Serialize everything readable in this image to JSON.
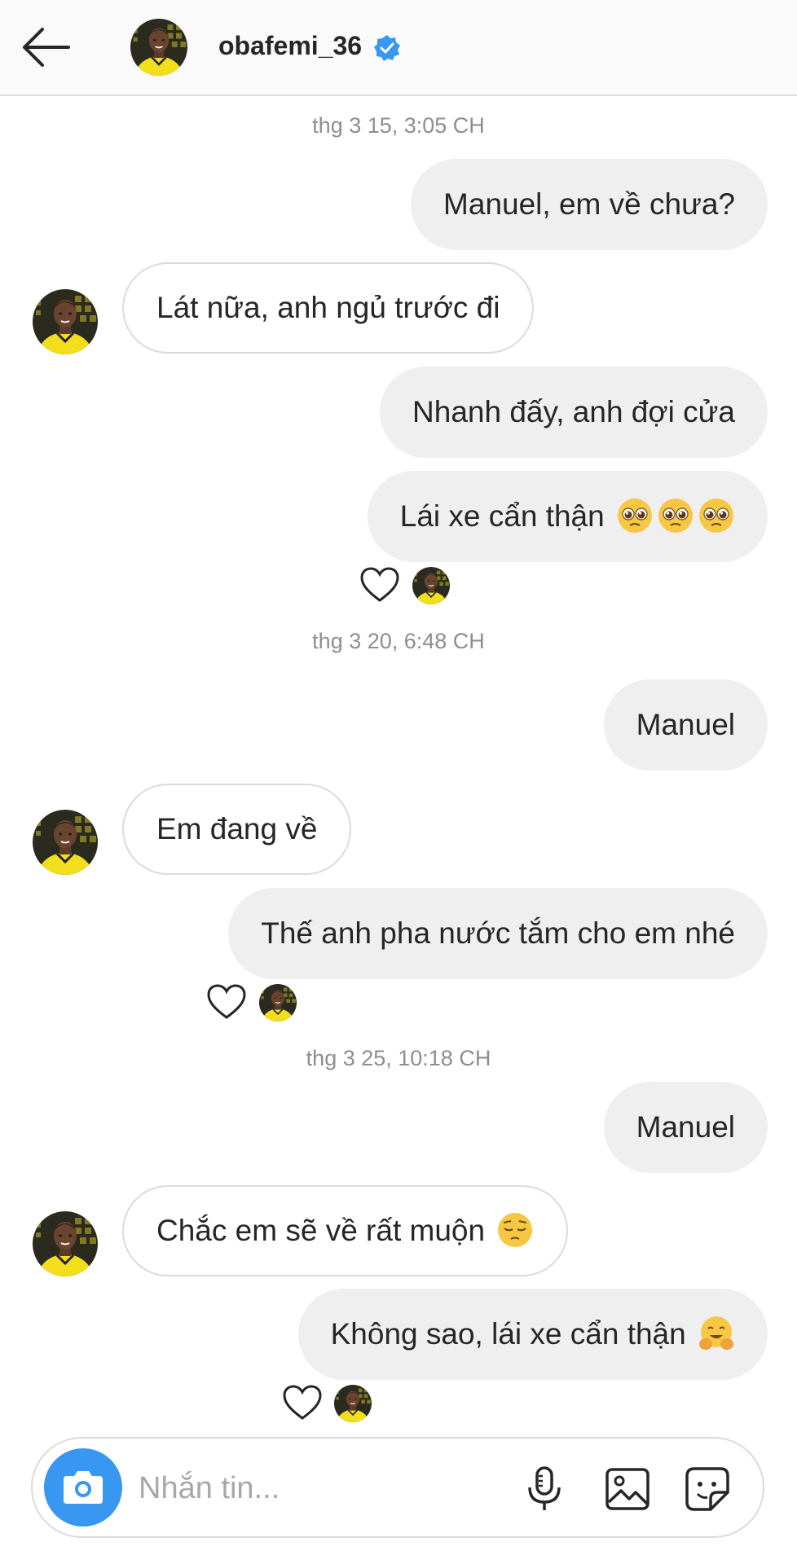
{
  "header": {
    "username": "obafemi_36",
    "back_icon": "arrow-left-icon",
    "verified_icon": "verified-badge-icon",
    "verified_color": "#3897f0"
  },
  "timestamps": [
    "thg 3 15, 3:05 CH",
    "thg 3 20, 6:48 CH",
    "thg 3 25, 10:18 CH"
  ],
  "messages": [
    {
      "sender": "me",
      "text": "Manuel, em về chưa?"
    },
    {
      "sender": "them",
      "text": "Lát nữa, anh ngủ trước đi"
    },
    {
      "sender": "me",
      "text": "Nhanh đấy, anh đợi cửa"
    },
    {
      "sender": "me",
      "text": "Lái xe cẩn thận",
      "emoji": [
        "pleading-face-emoji",
        "pleading-face-emoji",
        "pleading-face-emoji"
      ]
    },
    {
      "sender": "me",
      "text": "Manuel"
    },
    {
      "sender": "them",
      "text": "Em đang về"
    },
    {
      "sender": "me",
      "text": "Thế anh pha nước tắm cho em nhé"
    },
    {
      "sender": "me",
      "text": "Manuel"
    },
    {
      "sender": "them",
      "text": "Chắc em sẽ về rất muộn",
      "emoji": [
        "pensive-face-emoji"
      ]
    },
    {
      "sender": "me",
      "text": "Không sao, lái xe cẩn thận",
      "emoji": [
        "hugging-face-emoji"
      ]
    }
  ],
  "composer": {
    "placeholder": "Nhắn tin...",
    "camera_icon": "camera-icon",
    "mic_icon": "microphone-icon",
    "gallery_icon": "image-gallery-icon",
    "sticker_icon": "sticker-icon",
    "camera_color": "#3897f0"
  },
  "colors": {
    "my_bubble": "#efefef",
    "their_bubble_border": "#dbdbdb",
    "timestamp": "#8e8e8e"
  }
}
